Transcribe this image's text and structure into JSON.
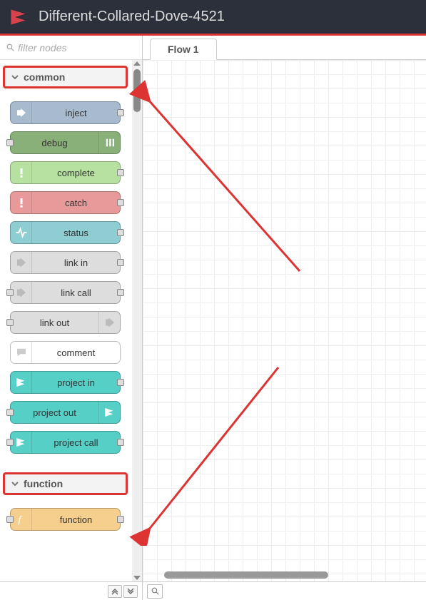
{
  "header": {
    "title": "Different-Collared-Dove-4521"
  },
  "filter": {
    "placeholder": "filter nodes"
  },
  "tabs": [
    {
      "label": "Flow 1"
    }
  ],
  "categories": [
    {
      "name": "common",
      "highlighted": true,
      "nodes": [
        {
          "label": "inject",
          "color": "c-inject",
          "icon": "inject",
          "icon_side": "left",
          "port_in": false,
          "port_out": true
        },
        {
          "label": "debug",
          "color": "c-debug",
          "icon": "debug",
          "icon_side": "right",
          "port_in": true,
          "port_out": false
        },
        {
          "label": "complete",
          "color": "c-complete",
          "icon": "alert",
          "icon_side": "left",
          "port_in": false,
          "port_out": true
        },
        {
          "label": "catch",
          "color": "c-catch",
          "icon": "alert",
          "icon_side": "left",
          "port_in": false,
          "port_out": true
        },
        {
          "label": "status",
          "color": "c-status",
          "icon": "status",
          "icon_side": "left",
          "port_in": false,
          "port_out": true
        },
        {
          "label": "link in",
          "color": "c-link",
          "icon": "link-in",
          "icon_side": "left",
          "port_in": false,
          "port_out": true
        },
        {
          "label": "link call",
          "color": "c-link",
          "icon": "link-in",
          "icon_side": "left",
          "port_in": true,
          "port_out": true
        },
        {
          "label": "link out",
          "color": "c-link",
          "icon": "link-out",
          "icon_side": "right",
          "port_in": true,
          "port_out": false
        },
        {
          "label": "comment",
          "color": "c-comment",
          "icon": "comment",
          "icon_side": "left",
          "port_in": false,
          "port_out": false
        },
        {
          "label": "project in",
          "color": "c-project",
          "icon": "project",
          "icon_side": "left",
          "port_in": false,
          "port_out": true
        },
        {
          "label": "project out",
          "color": "c-project",
          "icon": "project",
          "icon_side": "right",
          "port_in": true,
          "port_out": false
        },
        {
          "label": "project call",
          "color": "c-project",
          "icon": "project",
          "icon_side": "left",
          "port_in": true,
          "port_out": true
        }
      ]
    },
    {
      "name": "function",
      "highlighted": true,
      "nodes": [
        {
          "label": "function",
          "color": "c-function",
          "icon": "function",
          "icon_side": "left",
          "port_in": true,
          "port_out": true
        }
      ]
    }
  ]
}
